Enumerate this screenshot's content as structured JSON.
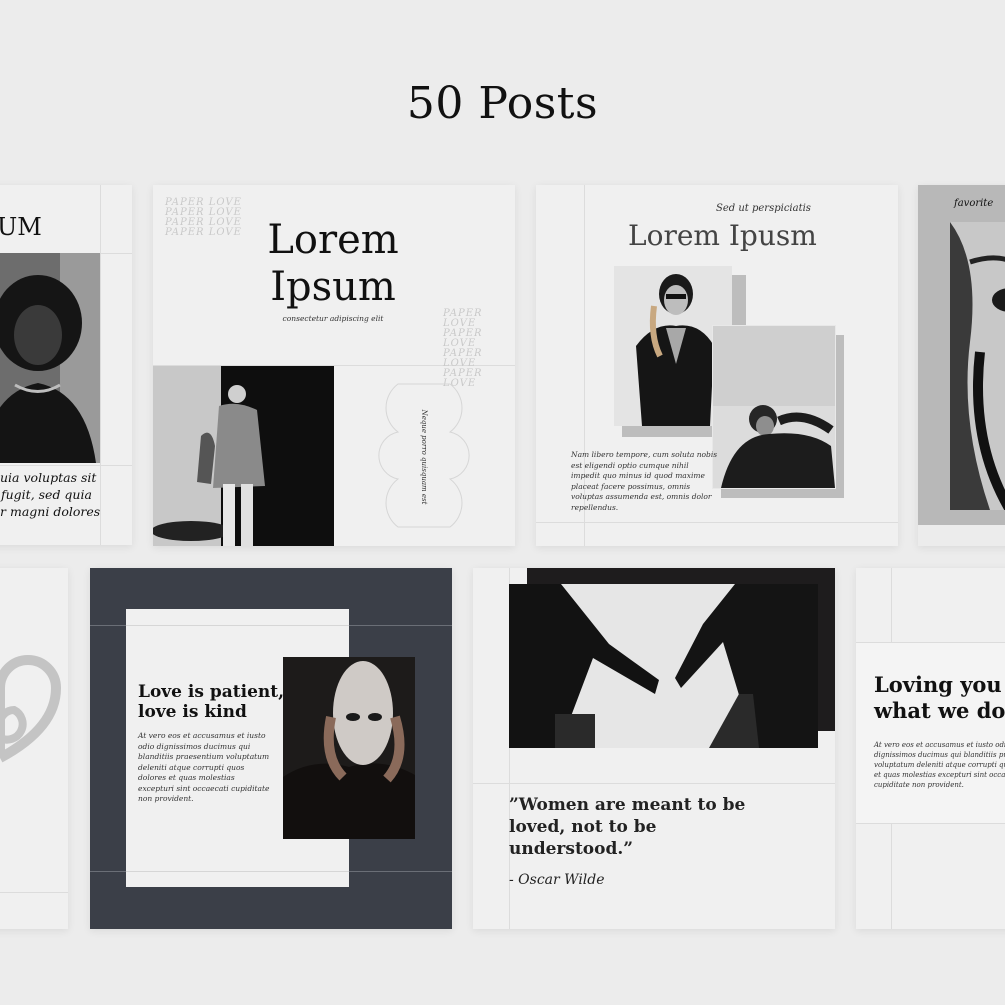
{
  "header": {
    "title": "50 Posts"
  },
  "card1": {
    "heading_fragment": "UM",
    "caption_lines": [
      "quia voluptas sit",
      "t fugit, sed quia",
      "ur magni dolores"
    ]
  },
  "card2": {
    "paper_love_top": [
      "PAPER LOVE",
      "PAPER LOVE",
      "PAPER LOVE",
      "PAPER LOVE"
    ],
    "paper_love_bottom": [
      "PAPER LOVE",
      "PAPER LOVE",
      "PAPER LOVE",
      "PAPER LOVE"
    ],
    "title_line1": "Lorem",
    "title_line2": "Ipsum",
    "subtitle": "consectetur adipiscing elit",
    "vertical_text": "Neque porro quisquam est"
  },
  "card3": {
    "script_top": "Sed ut perspiciatis",
    "title": "Lorem Ipusm",
    "body_lines": [
      "Nam libero tempore, cum soluta nobis",
      "est eligendi optio cumque nihil",
      "impedit quo minus id quod maxime",
      "placeat facere possimus, omnis",
      "voluptas assumenda est, omnis dolor",
      "repellendus."
    ]
  },
  "card4": {
    "script_top": "favorite"
  },
  "card6": {
    "heading_line1": "Love is patient,",
    "heading_line2": "love is kind",
    "body_lines": [
      "At vero eos et accusamus et iusto",
      "odio dignissimos ducimus qui",
      "blanditiis praesentium voluptatum",
      "deleniti atque corrupti quos",
      "dolores et quas molestias",
      "excepturi sint occaecati cupiditate",
      "non provident."
    ]
  },
  "card7": {
    "quote_line1": "”Women are meant to be",
    "quote_line2": "loved, not to be",
    "quote_line3": "understood.”",
    "author": "- Oscar Wilde"
  },
  "card8": {
    "heading_line1": "Loving you",
    "heading_line2": "what we do",
    "body_lines": [
      "At vero eos et accusamus et iusto odio",
      "dignissimos ducimus qui blanditiis pra",
      "voluptatum deleniti atque corrupti qu",
      "et quas molestias excepturi sint occae",
      "cupiditate non provident."
    ]
  },
  "colors": {
    "background": "#ececec",
    "card": "#f0f0f0",
    "navy": "#3b3f48",
    "ink": "#111111"
  }
}
